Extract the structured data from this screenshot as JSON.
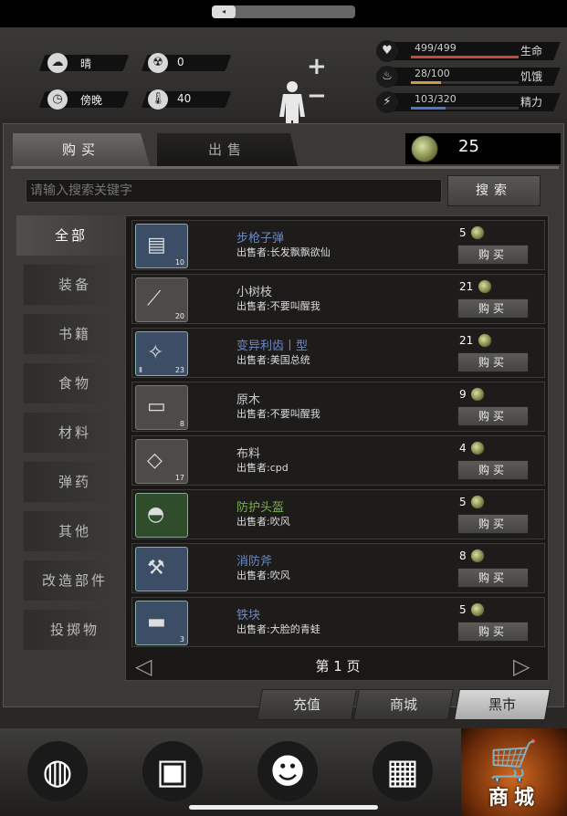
{
  "status": {
    "weather": "晴",
    "radiation": "0",
    "time_of_day": "傍晚",
    "temperature": "40",
    "stats": [
      {
        "value": "499/499",
        "label": "生命",
        "icon": "heart-icon",
        "fraction": 1.0,
        "color": "#c8483a"
      },
      {
        "value": "28/100",
        "label": "饥饿",
        "icon": "stomach-icon",
        "fraction": 0.28,
        "color": "#c89a4a"
      },
      {
        "value": "103/320",
        "label": "精力",
        "icon": "bolt-icon",
        "fraction": 0.32,
        "color": "#4a78c8"
      }
    ],
    "plus": "+",
    "minus": "−"
  },
  "shop": {
    "tabs": {
      "buy": "购买",
      "sell": "出售"
    },
    "coins": "25",
    "search_placeholder": "请输入搜索关键字",
    "search_button": "搜索",
    "categories": [
      "全部",
      "装备",
      "书籍",
      "食物",
      "材料",
      "弹药",
      "其他",
      "改造部件",
      "投掷物"
    ],
    "items": [
      {
        "name": "步枪子弹",
        "seller": "出售者:长发飘飘欲仙",
        "price": "5",
        "qty": "10",
        "color": "blue",
        "glyph": "▤"
      },
      {
        "name": "小树枝",
        "seller": "出售者:不要叫醒我",
        "price": "21",
        "qty": "20",
        "color": "white",
        "glyph": "⟋"
      },
      {
        "name": "变异利齿丨型",
        "seller": "出售者:美国总统",
        "price": "21",
        "qty": "23",
        "color": "blue",
        "glyph": "✧",
        "tier": "Ⅱ"
      },
      {
        "name": "原木",
        "seller": "出售者:不要叫醒我",
        "price": "9",
        "qty": "8",
        "color": "white",
        "glyph": "▭"
      },
      {
        "name": "布料",
        "seller": "出售者:cpd",
        "price": "4",
        "qty": "17",
        "color": "white",
        "glyph": "◇"
      },
      {
        "name": "防护头盔",
        "seller": "出售者:吹风",
        "price": "5",
        "qty": "",
        "color": "green",
        "glyph": "◓"
      },
      {
        "name": "消防斧",
        "seller": "出售者:吹风",
        "price": "8",
        "qty": "",
        "color": "blue",
        "glyph": "⚒"
      },
      {
        "name": "铁块",
        "seller": "出售者:大脸的青蛙",
        "price": "5",
        "qty": "3",
        "color": "blue",
        "glyph": "▬"
      }
    ],
    "buy_label": "购买",
    "page_label": "第 1 页",
    "prev": "◁",
    "next": "▷",
    "subtabs": [
      "充值",
      "商城",
      "黑市"
    ]
  },
  "nav": {
    "items": [
      {
        "icon": "globe-icon",
        "glyph": "◍"
      },
      {
        "icon": "backpack-icon",
        "glyph": "▣"
      },
      {
        "icon": "head-gears-icon",
        "glyph": "☻"
      },
      {
        "icon": "radio-icon",
        "glyph": "▦"
      }
    ],
    "shop_label": "商城",
    "shop_glyph": "🛒"
  }
}
